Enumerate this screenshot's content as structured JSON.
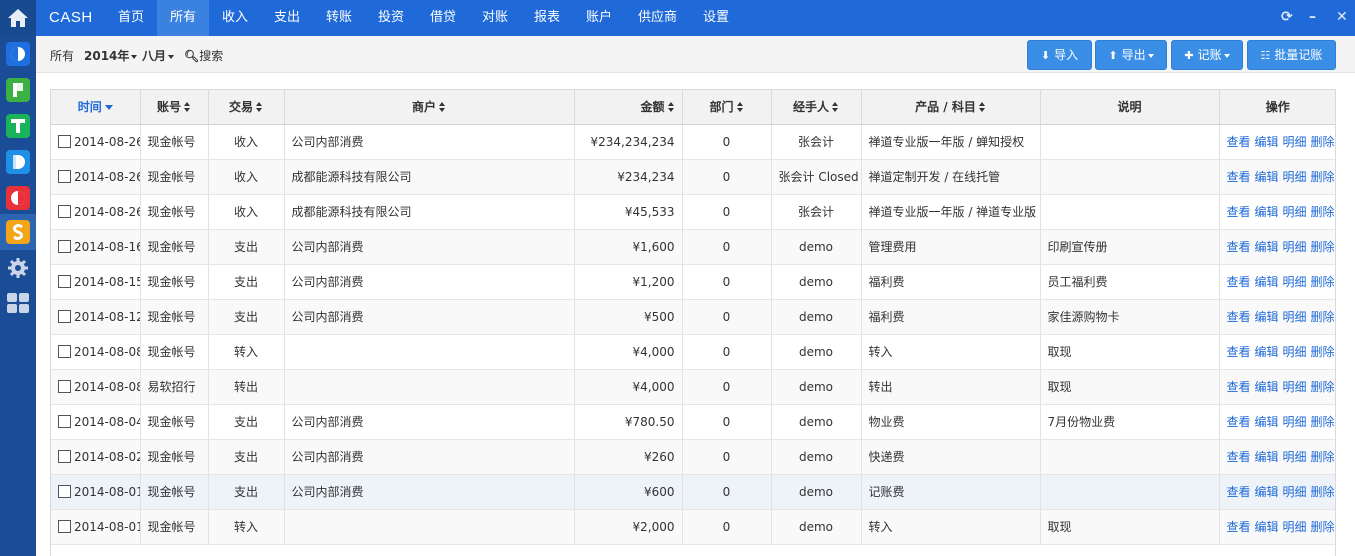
{
  "app": {
    "brand": "CASH",
    "nav": [
      "首页",
      "所有",
      "收入",
      "支出",
      "转账",
      "投资",
      "借贷",
      "对账",
      "报表",
      "账户",
      "供应商",
      "设置"
    ],
    "active_nav": "所有",
    "rail_apps": [
      {
        "name": "home-icon",
        "letter": ""
      },
      {
        "name": "app-c-icon",
        "letter": "C",
        "color": "#1e6fe0"
      },
      {
        "name": "app-p-icon",
        "letter": "P",
        "color": "#3cb043"
      },
      {
        "name": "app-t-icon",
        "letter": "T",
        "color": "#1ab35a"
      },
      {
        "name": "app-d-icon",
        "letter": "D",
        "color": "#1e90e8"
      },
      {
        "name": "app-o-icon",
        "letter": "O",
        "color": "#e8313a"
      },
      {
        "name": "app-s-icon",
        "letter": "S",
        "color": "#f2a516"
      },
      {
        "name": "settings-icon",
        "letter": ""
      },
      {
        "name": "grid-icon",
        "letter": ""
      }
    ]
  },
  "toolbar": {
    "scope": "所有",
    "year": "2014年",
    "month": "八月",
    "search": "搜索",
    "import": "导入",
    "export": "导出",
    "record": "记账",
    "batch": "批量记账"
  },
  "table": {
    "headers": [
      "时间",
      "账号",
      "交易",
      "商户",
      "金额",
      "部门",
      "经手人",
      "产品 / 科目",
      "说明",
      "操作"
    ],
    "actions": [
      "查看",
      "编辑",
      "明细",
      "删除"
    ],
    "rows": [
      [
        "2014-08-26",
        "现金帐号",
        "收入",
        "公司内部消费",
        "¥234,234,234",
        "0",
        "张会计",
        "禅道专业版一年版 / 蝉知授权",
        ""
      ],
      [
        "2014-08-26",
        "现金帐号",
        "收入",
        "成都能源科技有限公司",
        "¥234,234",
        "0",
        "张会计 Closed",
        "禅道定制开发 / 在线托管",
        ""
      ],
      [
        "2014-08-26",
        "现金帐号",
        "收入",
        "成都能源科技有限公司",
        "¥45,533",
        "0",
        "张会计",
        "禅道专业版一年版 / 禅道专业版",
        ""
      ],
      [
        "2014-08-16",
        "现金帐号",
        "支出",
        "公司内部消费",
        "¥1,600",
        "0",
        "demo",
        "管理费用",
        "印刷宣传册"
      ],
      [
        "2014-08-15",
        "现金帐号",
        "支出",
        "公司内部消费",
        "¥1,200",
        "0",
        "demo",
        "福利费",
        "员工福利费"
      ],
      [
        "2014-08-12",
        "现金帐号",
        "支出",
        "公司内部消费",
        "¥500",
        "0",
        "demo",
        "福利费",
        "家佳源购物卡"
      ],
      [
        "2014-08-08",
        "现金帐号",
        "转入",
        "",
        "¥4,000",
        "0",
        "demo",
        "转入",
        "取现"
      ],
      [
        "2014-08-08",
        "易软招行",
        "转出",
        "",
        "¥4,000",
        "0",
        "demo",
        "转出",
        "取现"
      ],
      [
        "2014-08-04",
        "现金帐号",
        "支出",
        "公司内部消费",
        "¥780.50",
        "0",
        "demo",
        "物业费",
        "7月份物业费"
      ],
      [
        "2014-08-02",
        "现金帐号",
        "支出",
        "公司内部消费",
        "¥260",
        "0",
        "demo",
        "快递费",
        ""
      ],
      [
        "2014-08-01",
        "现金帐号",
        "支出",
        "公司内部消费",
        "¥600",
        "0",
        "demo",
        "记账费",
        ""
      ],
      [
        "2014-08-01",
        "现金帐号",
        "转入",
        "",
        "¥2,000",
        "0",
        "demo",
        "转入",
        "取现"
      ]
    ]
  }
}
